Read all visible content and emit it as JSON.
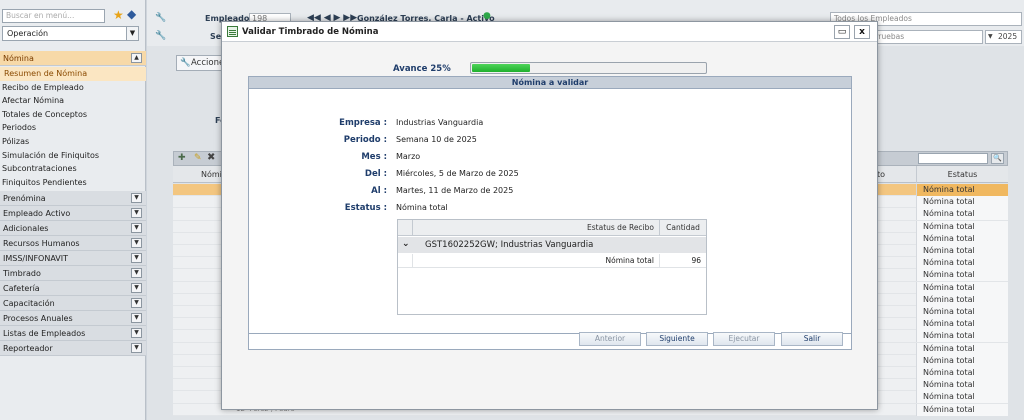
{
  "sidebar": {
    "search_placeholder": "Buscar en menú...",
    "module_selected": "Operación",
    "active_section": "Nómina",
    "nomina_items": [
      "Resumen de Nómina",
      "Recibo de Empleado",
      "Afectar Nómina",
      "Totales de Conceptos",
      "Periodos",
      "Pólizas",
      "Simulación de Finiquitos",
      "Subcontrataciones",
      "Finiquitos Pendientes"
    ],
    "sections": [
      "Prenómina",
      "Empleado Activo",
      "Adicionales",
      "Recursos Humanos",
      "IMSS/INFONAVIT",
      "Timbrado",
      "Cafetería",
      "Capacitación",
      "Procesos Anuales",
      "Listas de Empleados",
      "Reporteador"
    ]
  },
  "background": {
    "empleado_label": "Empleado",
    "empleado_num": "198",
    "empleado_name": "González Torres, Carla - Activo",
    "se_label": "Se",
    "acciones_label": "Acciones",
    "fe_label": "Fe",
    "todos_empleados": "Todos los Empleados",
    "pruebas": "Pruebas",
    "year": "2025",
    "col_nombre": "Nómi",
    "col_to": "to",
    "col_estatus": "Estatus",
    "row_status": "Nómina total",
    "row_count": 19,
    "last_row_num": "12",
    "last_row_name": "Pérez , Pedro"
  },
  "modal": {
    "title": "Validar Timbrado de Nómina",
    "restore_label": "▭",
    "close_label": "x",
    "progress_label": "Avance 25%",
    "progress_fraction": 0.25,
    "panel_title": "Nómina a validar",
    "fields": [
      {
        "label": "Empresa :",
        "value": "Industrias Vanguardia"
      },
      {
        "label": "Periodo :",
        "value": "Semana 10 de 2025"
      },
      {
        "label": "Mes :",
        "value": "Marzo"
      },
      {
        "label": "Del :",
        "value": "Miércoles, 5 de Marzo de 2025"
      },
      {
        "label": "Al :",
        "value": "Martes, 11 de Marzo de 2025"
      },
      {
        "label": "Estatus :",
        "value": "Nómina total"
      }
    ],
    "table": {
      "col_estatus": "Estatus de Recibo",
      "col_cantidad": "Cantidad",
      "group": "GST1602252GW; Industrias Vanguardia",
      "row_estatus": "Nómina total",
      "row_cantidad": "96"
    },
    "buttons": {
      "anterior": "Anterior",
      "siguiente": "Siguiente",
      "ejecutar": "Ejecutar",
      "salir": "Salir"
    }
  }
}
